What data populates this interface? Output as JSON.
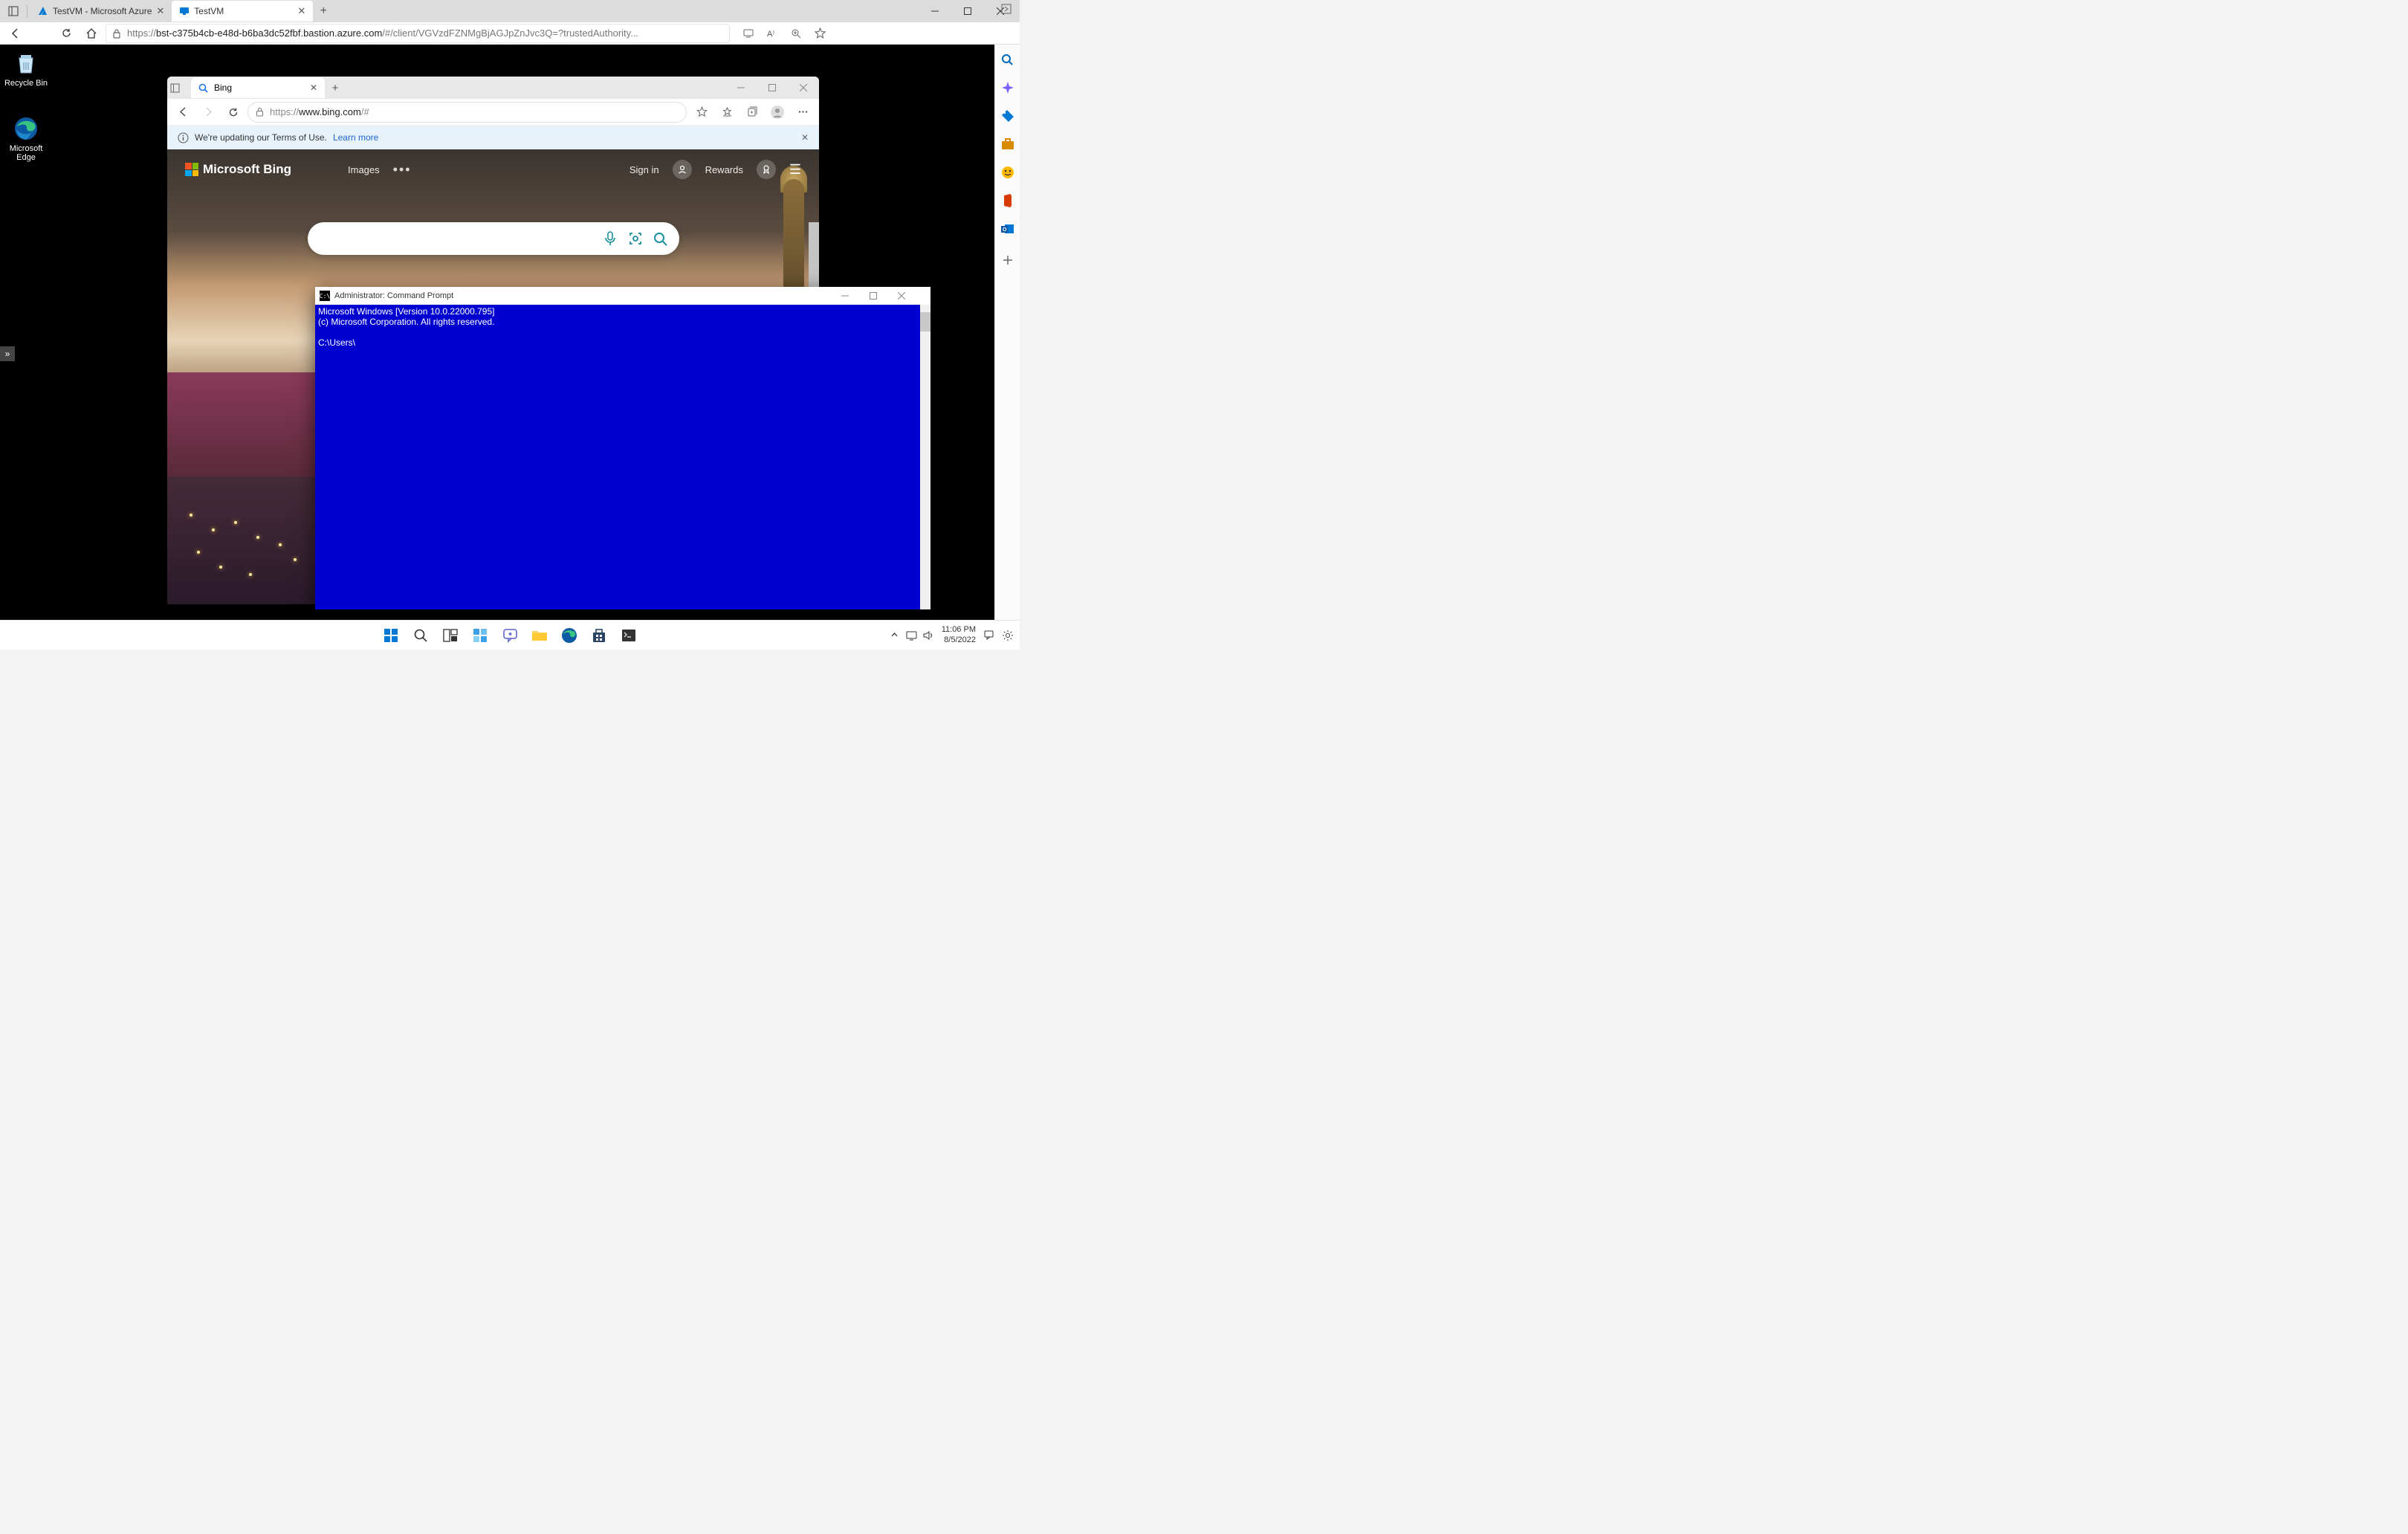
{
  "outer": {
    "tabs": [
      {
        "title": "TestVM  - Microsoft Azure",
        "active": false
      },
      {
        "title": "TestVM",
        "active": true
      }
    ],
    "url_prefix": "https://",
    "url_host": "bst-c375b4cb-e48d-b6ba3dc52fbf.bastion.azure.com",
    "url_path": "/#/client/VGVzdFZNMgBjAGJpZnJvc3Q=?trustedAuthority..."
  },
  "desktop": {
    "recycle": "Recycle Bin",
    "edge": "Microsoft Edge"
  },
  "inner_edge": {
    "tab_title": "Bing",
    "url_prefix": "https://",
    "url_host": "www.bing.com",
    "url_path": "/#",
    "banner_text": "We're updating our Terms of Use.",
    "banner_link": "Learn more",
    "logo_text": "Microsoft Bing",
    "nav_images": "Images",
    "signin": "Sign in",
    "rewards": "Rewards",
    "search_placeholder": ""
  },
  "cmd": {
    "title": "Administrator: Command Prompt",
    "line1": "Microsoft Windows [Version 10.0.22000.795]",
    "line2": "(c) Microsoft Corporation. All rights reserved.",
    "prompt": "C:\\Users\\"
  },
  "taskbar": {
    "time": "11:06 PM",
    "date": "8/5/2022"
  }
}
